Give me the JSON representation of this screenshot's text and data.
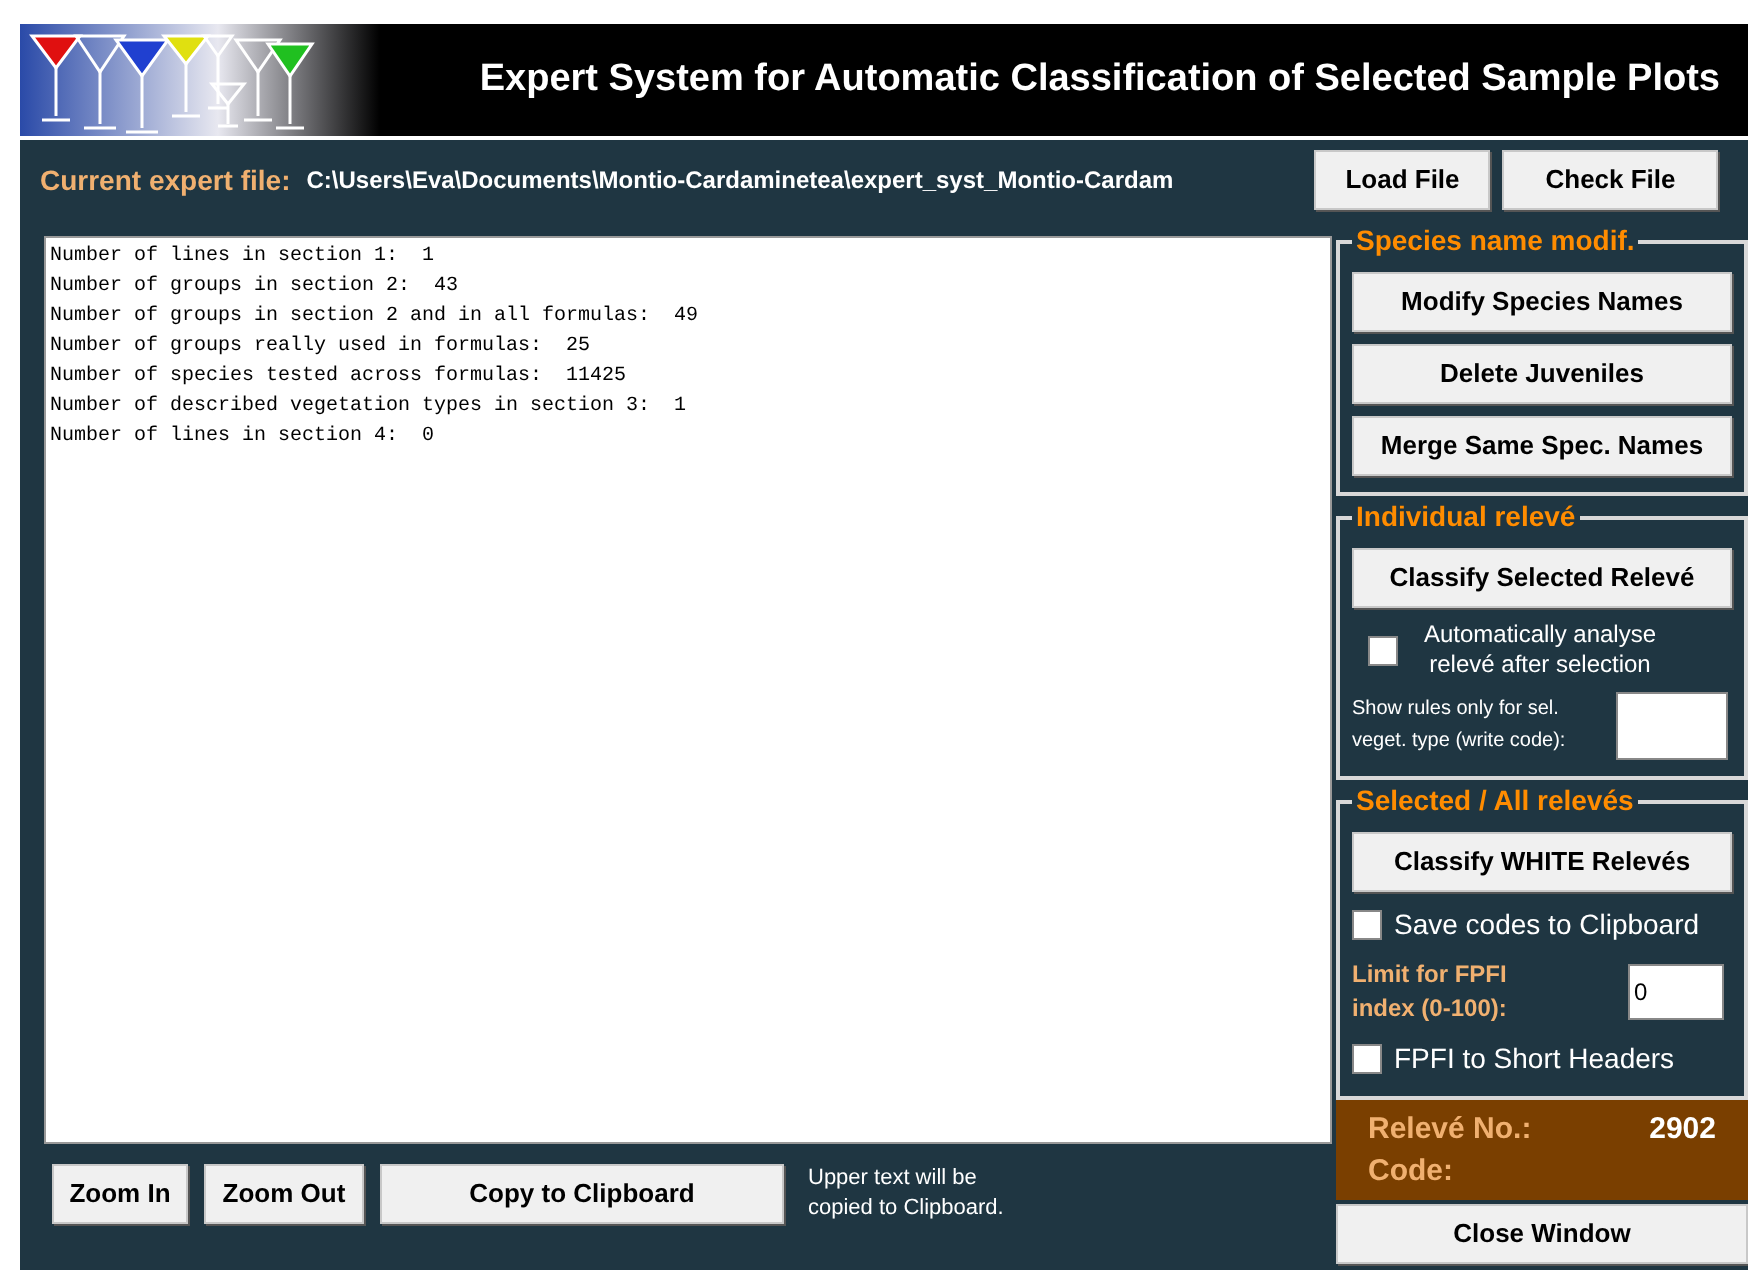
{
  "header": {
    "title": "Expert System for Automatic Classification of Selected Sample Plots"
  },
  "file_row": {
    "label": "Current expert file:",
    "path": "C:\\Users\\Eva\\Documents\\Montio-Cardaminetea\\expert_syst_Montio-Cardam",
    "buttons": [
      "Load File",
      "Check File"
    ]
  },
  "output_lines": [
    "Number of lines in section 1:  1",
    "Number of groups in section 2:  43",
    "Number of groups in section 2 and in all formulas:  49",
    "Number of groups really used in formulas:  25",
    "Number of species tested across formulas:  11425",
    "Number of described vegetation types in section 3:  1",
    "Number of lines in section 4:  0"
  ],
  "bottom_bar": {
    "buttons": [
      "Zoom In",
      "Zoom Out",
      "Copy to Clipboard"
    ],
    "note": "Upper text will be copied to Clipboard."
  },
  "species_group": {
    "title": "Species name modif.",
    "buttons": [
      "Modify Species Names",
      "Delete Juveniles",
      "Merge Same Spec. Names"
    ]
  },
  "individual_group": {
    "title": "Individual relevé",
    "button": "Classify Selected Relevé",
    "auto_checkbox": {
      "label": "Automatically analyse relevé after selection",
      "checked": false
    },
    "code_field": {
      "label": "Show rules only for sel. veget. type (write code):"
    }
  },
  "all_group": {
    "title": "Selected / All relevés",
    "button": "Classify WHITE Relevés",
    "clipboard_checkbox": {
      "label": "Save codes to Clipboard",
      "checked": false
    },
    "limit_field": {
      "label": "Limit for FPFI index (0-100):",
      "value": "0"
    },
    "headers_checkbox": {
      "label": "FPFI to Short Headers",
      "checked": false
    }
  },
  "status": {
    "releve_label": "Relevé No.:",
    "releve_value": "2902",
    "code_label": "Code:"
  },
  "close_button": "Close Window"
}
